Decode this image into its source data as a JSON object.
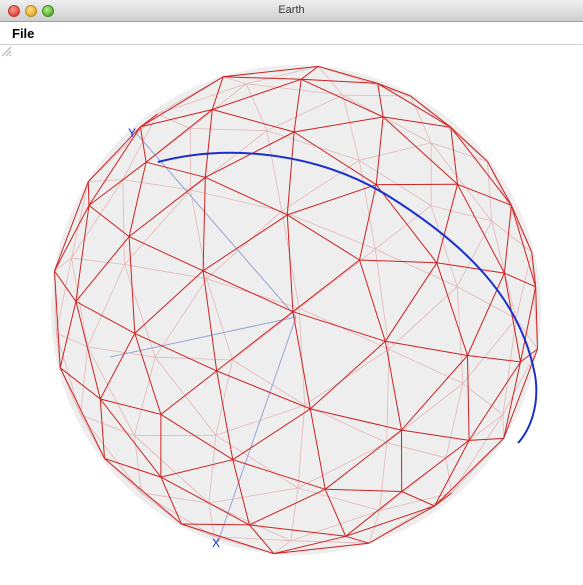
{
  "window": {
    "title": "Earth",
    "buttons": [
      "close",
      "minimize",
      "zoom"
    ]
  },
  "menubar": {
    "items": [
      "File"
    ]
  },
  "scene": {
    "axis_labels": [
      "Y",
      "X"
    ],
    "colors": {
      "mesh": "#cc2222",
      "orbit": "#1a2fcc",
      "axis": "#9aa4d8",
      "sphere_fill": "#eeeeee"
    },
    "icons": [
      "geodesic-sphere-icon",
      "resize-grip-icon"
    ]
  }
}
